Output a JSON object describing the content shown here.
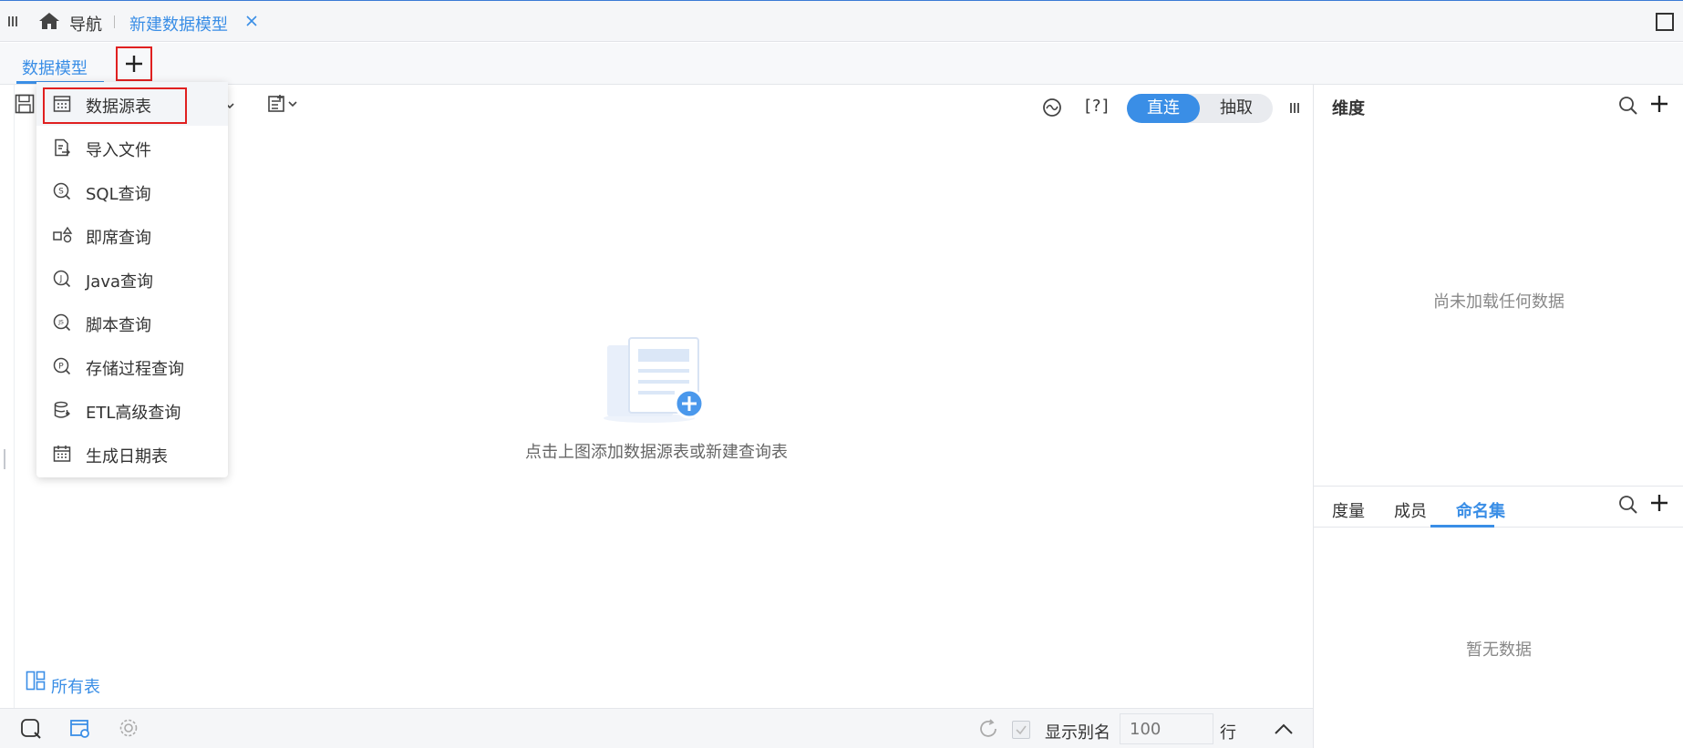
{
  "topbar": {
    "nav_label": "导航",
    "open_tab_label": "新建数据模型"
  },
  "subtab": {
    "model_tab_label": "数据模型"
  },
  "modes": {
    "active": "直连",
    "inactive": "抽取"
  },
  "help_label": "[?]",
  "canvas": {
    "empty_text": "点击上图添加数据源表或新建查询表",
    "all_tables_label": "所有表"
  },
  "dropdown": {
    "items": [
      {
        "label": "数据源表",
        "icon": "table-grid-icon"
      },
      {
        "label": "导入文件",
        "icon": "import-file-icon"
      },
      {
        "label": "SQL查询",
        "icon": "sql-query-icon"
      },
      {
        "label": "即席查询",
        "icon": "adhoc-query-icon"
      },
      {
        "label": "Java查询",
        "icon": "java-query-icon"
      },
      {
        "label": "脚本查询",
        "icon": "script-query-icon"
      },
      {
        "label": "存储过程查询",
        "icon": "procedure-query-icon"
      },
      {
        "label": "ETL高级查询",
        "icon": "etl-query-icon"
      },
      {
        "label": "生成日期表",
        "icon": "calendar-icon"
      }
    ]
  },
  "right_panel": {
    "dimension_title": "维度",
    "dimension_empty": "尚未加载任何数据",
    "tabs": [
      "度量",
      "成员",
      "命名集"
    ],
    "active_tab": "命名集",
    "measure_empty": "暂无数据"
  },
  "bottombar": {
    "alias_label": "显示别名",
    "rows_placeholder": "100",
    "rows_unit": "行"
  },
  "colors": {
    "accent": "#3a8ee6",
    "highlight": "#e02020"
  }
}
